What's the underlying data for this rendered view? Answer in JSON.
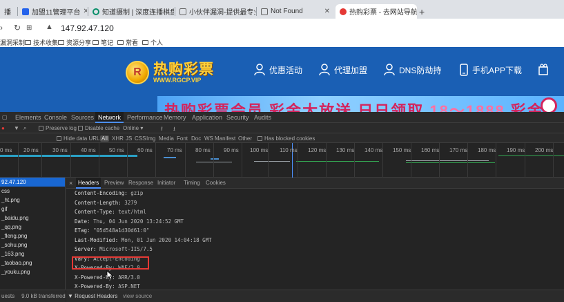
{
  "browser": {
    "tabs": [
      {
        "label": "播",
        "active": false
      },
      {
        "label": "加盟11管理平台",
        "active": false
      },
      {
        "label": "知道摄制 | 深度连播棋盘推广",
        "active": false
      },
      {
        "label": "小伙伴漏洞-提供最专业的伙伴",
        "active": false
      },
      {
        "label": "Not Found",
        "active": false
      },
      {
        "label": "热购彩票 - 去网站导航",
        "active": true
      }
    ],
    "new_tab": "+",
    "url": "147.92.47.120",
    "bookmarks": [
      "漏洞采制",
      "技术收集",
      "资源分享",
      "笔记",
      "常看",
      "个人"
    ]
  },
  "site": {
    "logo_letter": "R",
    "logo_cn": "热购彩票",
    "logo_en": "WWW.RGCP.VIP",
    "nav": [
      {
        "label": "优惠活动",
        "icon": "user-icon"
      },
      {
        "label": "代理加盟",
        "icon": "user-icon"
      },
      {
        "label": "DNS防劫持",
        "icon": "user-icon"
      },
      {
        "label": "手机APP下载",
        "icon": "phone-icon"
      }
    ],
    "banner_text_a": "热购彩票会员 彩金大放送 日日领取",
    "banner_text_b": "18～1888",
    "banner_text_c": "彩金"
  },
  "devtools": {
    "tabs": [
      "Elements",
      "Console",
      "Sources",
      "Network",
      "Performance",
      "Memory",
      "Application",
      "Security",
      "Audits"
    ],
    "active_tab": "Network",
    "toolbar": {
      "preserve_log": "Preserve log",
      "disable_cache": "Disable cache",
      "throttle": "Online"
    },
    "filter": {
      "hide_data_urls": "Hide data URLs",
      "types": [
        "All",
        "XHR",
        "JS",
        "CSS",
        "Img",
        "Media",
        "Font",
        "Doc",
        "WS",
        "Manifest",
        "Other"
      ],
      "active_type": "All",
      "blocked_cookies": "Has blocked cookies"
    },
    "timeline_ticks": [
      "0 ms",
      "20 ms",
      "30 ms",
      "40 ms",
      "50 ms",
      "60 ms",
      "70 ms",
      "80 ms",
      "90 ms",
      "100 ms",
      "110 ms",
      "120 ms",
      "130 ms",
      "140 ms",
      "150 ms",
      "160 ms",
      "170 ms",
      "180 ms",
      "190 ms",
      "200 ms"
    ],
    "requests": [
      "92.47.120",
      "css",
      "_ht.png",
      "gif",
      "_baidu.png",
      "_qq.png",
      "_fleng.png",
      "_sohu.png",
      "_163.png",
      "_taobao.png",
      "_youku.png"
    ],
    "selected_request": "92.47.120",
    "footer": {
      "requests": "uests",
      "transferred": "9.0 kB transferred"
    },
    "detail_tabs": [
      "Headers",
      "Preview",
      "Response",
      "Initiator",
      "Timing",
      "Cookies"
    ],
    "active_detail_tab": "Headers",
    "close_glyph": "×",
    "headers": [
      {
        "key": "Content-Encoding:",
        "value": "gzip"
      },
      {
        "key": "Content-Length:",
        "value": "3279"
      },
      {
        "key": "Content-Type:",
        "value": "text/html"
      },
      {
        "key": "Date:",
        "value": "Thu, 04 Jun 2020 13:24:52 GMT"
      },
      {
        "key": "ETag:",
        "value": "\"05d548a1d30d61:0\""
      },
      {
        "key": "Last-Modified:",
        "value": "Mon, 01 Jun 2020 14:04:18 GMT"
      },
      {
        "key": "Server:",
        "value": "Microsoft-IIS/7.5"
      },
      {
        "key": "Vary:",
        "value": "Accept-Encoding"
      },
      {
        "key": "X-Powered-By:",
        "value": "WAF/2.0"
      },
      {
        "key": "X-Powered-By:",
        "value": "ARR/3.0"
      },
      {
        "key": "X-Powered-By:",
        "value": "ASP.NET"
      }
    ],
    "request_headers": "▼ Request Headers",
    "view_source": "view source"
  }
}
